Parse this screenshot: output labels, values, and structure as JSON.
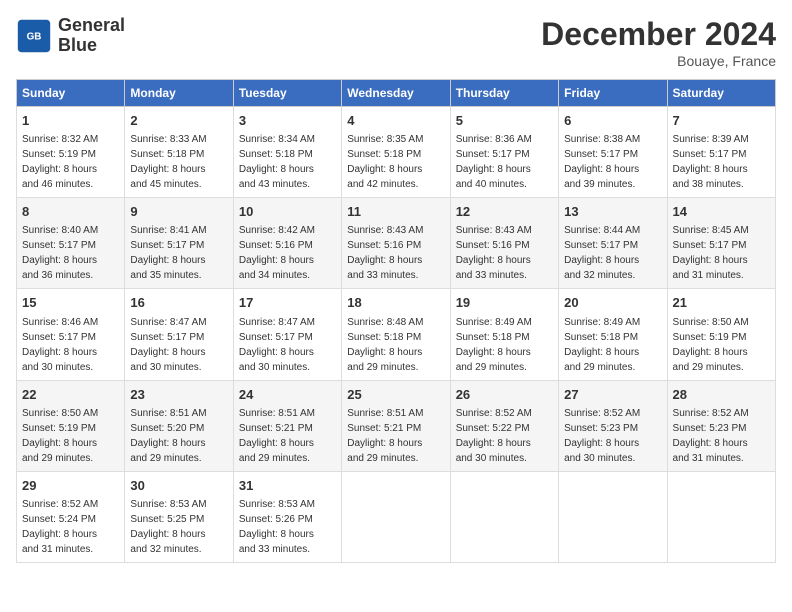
{
  "header": {
    "logo_line1": "General",
    "logo_line2": "Blue",
    "month": "December 2024",
    "location": "Bouaye, France"
  },
  "days_of_week": [
    "Sunday",
    "Monday",
    "Tuesday",
    "Wednesday",
    "Thursday",
    "Friday",
    "Saturday"
  ],
  "weeks": [
    [
      {
        "day": "1",
        "detail": "Sunrise: 8:32 AM\nSunset: 5:19 PM\nDaylight: 8 hours\nand 46 minutes."
      },
      {
        "day": "2",
        "detail": "Sunrise: 8:33 AM\nSunset: 5:18 PM\nDaylight: 8 hours\nand 45 minutes."
      },
      {
        "day": "3",
        "detail": "Sunrise: 8:34 AM\nSunset: 5:18 PM\nDaylight: 8 hours\nand 43 minutes."
      },
      {
        "day": "4",
        "detail": "Sunrise: 8:35 AM\nSunset: 5:18 PM\nDaylight: 8 hours\nand 42 minutes."
      },
      {
        "day": "5",
        "detail": "Sunrise: 8:36 AM\nSunset: 5:17 PM\nDaylight: 8 hours\nand 40 minutes."
      },
      {
        "day": "6",
        "detail": "Sunrise: 8:38 AM\nSunset: 5:17 PM\nDaylight: 8 hours\nand 39 minutes."
      },
      {
        "day": "7",
        "detail": "Sunrise: 8:39 AM\nSunset: 5:17 PM\nDaylight: 8 hours\nand 38 minutes."
      }
    ],
    [
      {
        "day": "8",
        "detail": "Sunrise: 8:40 AM\nSunset: 5:17 PM\nDaylight: 8 hours\nand 36 minutes."
      },
      {
        "day": "9",
        "detail": "Sunrise: 8:41 AM\nSunset: 5:17 PM\nDaylight: 8 hours\nand 35 minutes."
      },
      {
        "day": "10",
        "detail": "Sunrise: 8:42 AM\nSunset: 5:16 PM\nDaylight: 8 hours\nand 34 minutes."
      },
      {
        "day": "11",
        "detail": "Sunrise: 8:43 AM\nSunset: 5:16 PM\nDaylight: 8 hours\nand 33 minutes."
      },
      {
        "day": "12",
        "detail": "Sunrise: 8:43 AM\nSunset: 5:16 PM\nDaylight: 8 hours\nand 33 minutes."
      },
      {
        "day": "13",
        "detail": "Sunrise: 8:44 AM\nSunset: 5:17 PM\nDaylight: 8 hours\nand 32 minutes."
      },
      {
        "day": "14",
        "detail": "Sunrise: 8:45 AM\nSunset: 5:17 PM\nDaylight: 8 hours\nand 31 minutes."
      }
    ],
    [
      {
        "day": "15",
        "detail": "Sunrise: 8:46 AM\nSunset: 5:17 PM\nDaylight: 8 hours\nand 30 minutes."
      },
      {
        "day": "16",
        "detail": "Sunrise: 8:47 AM\nSunset: 5:17 PM\nDaylight: 8 hours\nand 30 minutes."
      },
      {
        "day": "17",
        "detail": "Sunrise: 8:47 AM\nSunset: 5:17 PM\nDaylight: 8 hours\nand 30 minutes."
      },
      {
        "day": "18",
        "detail": "Sunrise: 8:48 AM\nSunset: 5:18 PM\nDaylight: 8 hours\nand 29 minutes."
      },
      {
        "day": "19",
        "detail": "Sunrise: 8:49 AM\nSunset: 5:18 PM\nDaylight: 8 hours\nand 29 minutes."
      },
      {
        "day": "20",
        "detail": "Sunrise: 8:49 AM\nSunset: 5:18 PM\nDaylight: 8 hours\nand 29 minutes."
      },
      {
        "day": "21",
        "detail": "Sunrise: 8:50 AM\nSunset: 5:19 PM\nDaylight: 8 hours\nand 29 minutes."
      }
    ],
    [
      {
        "day": "22",
        "detail": "Sunrise: 8:50 AM\nSunset: 5:19 PM\nDaylight: 8 hours\nand 29 minutes."
      },
      {
        "day": "23",
        "detail": "Sunrise: 8:51 AM\nSunset: 5:20 PM\nDaylight: 8 hours\nand 29 minutes."
      },
      {
        "day": "24",
        "detail": "Sunrise: 8:51 AM\nSunset: 5:21 PM\nDaylight: 8 hours\nand 29 minutes."
      },
      {
        "day": "25",
        "detail": "Sunrise: 8:51 AM\nSunset: 5:21 PM\nDaylight: 8 hours\nand 29 minutes."
      },
      {
        "day": "26",
        "detail": "Sunrise: 8:52 AM\nSunset: 5:22 PM\nDaylight: 8 hours\nand 30 minutes."
      },
      {
        "day": "27",
        "detail": "Sunrise: 8:52 AM\nSunset: 5:23 PM\nDaylight: 8 hours\nand 30 minutes."
      },
      {
        "day": "28",
        "detail": "Sunrise: 8:52 AM\nSunset: 5:23 PM\nDaylight: 8 hours\nand 31 minutes."
      }
    ],
    [
      {
        "day": "29",
        "detail": "Sunrise: 8:52 AM\nSunset: 5:24 PM\nDaylight: 8 hours\nand 31 minutes."
      },
      {
        "day": "30",
        "detail": "Sunrise: 8:53 AM\nSunset: 5:25 PM\nDaylight: 8 hours\nand 32 minutes."
      },
      {
        "day": "31",
        "detail": "Sunrise: 8:53 AM\nSunset: 5:26 PM\nDaylight: 8 hours\nand 33 minutes."
      },
      {
        "day": "",
        "detail": ""
      },
      {
        "day": "",
        "detail": ""
      },
      {
        "day": "",
        "detail": ""
      },
      {
        "day": "",
        "detail": ""
      }
    ]
  ]
}
